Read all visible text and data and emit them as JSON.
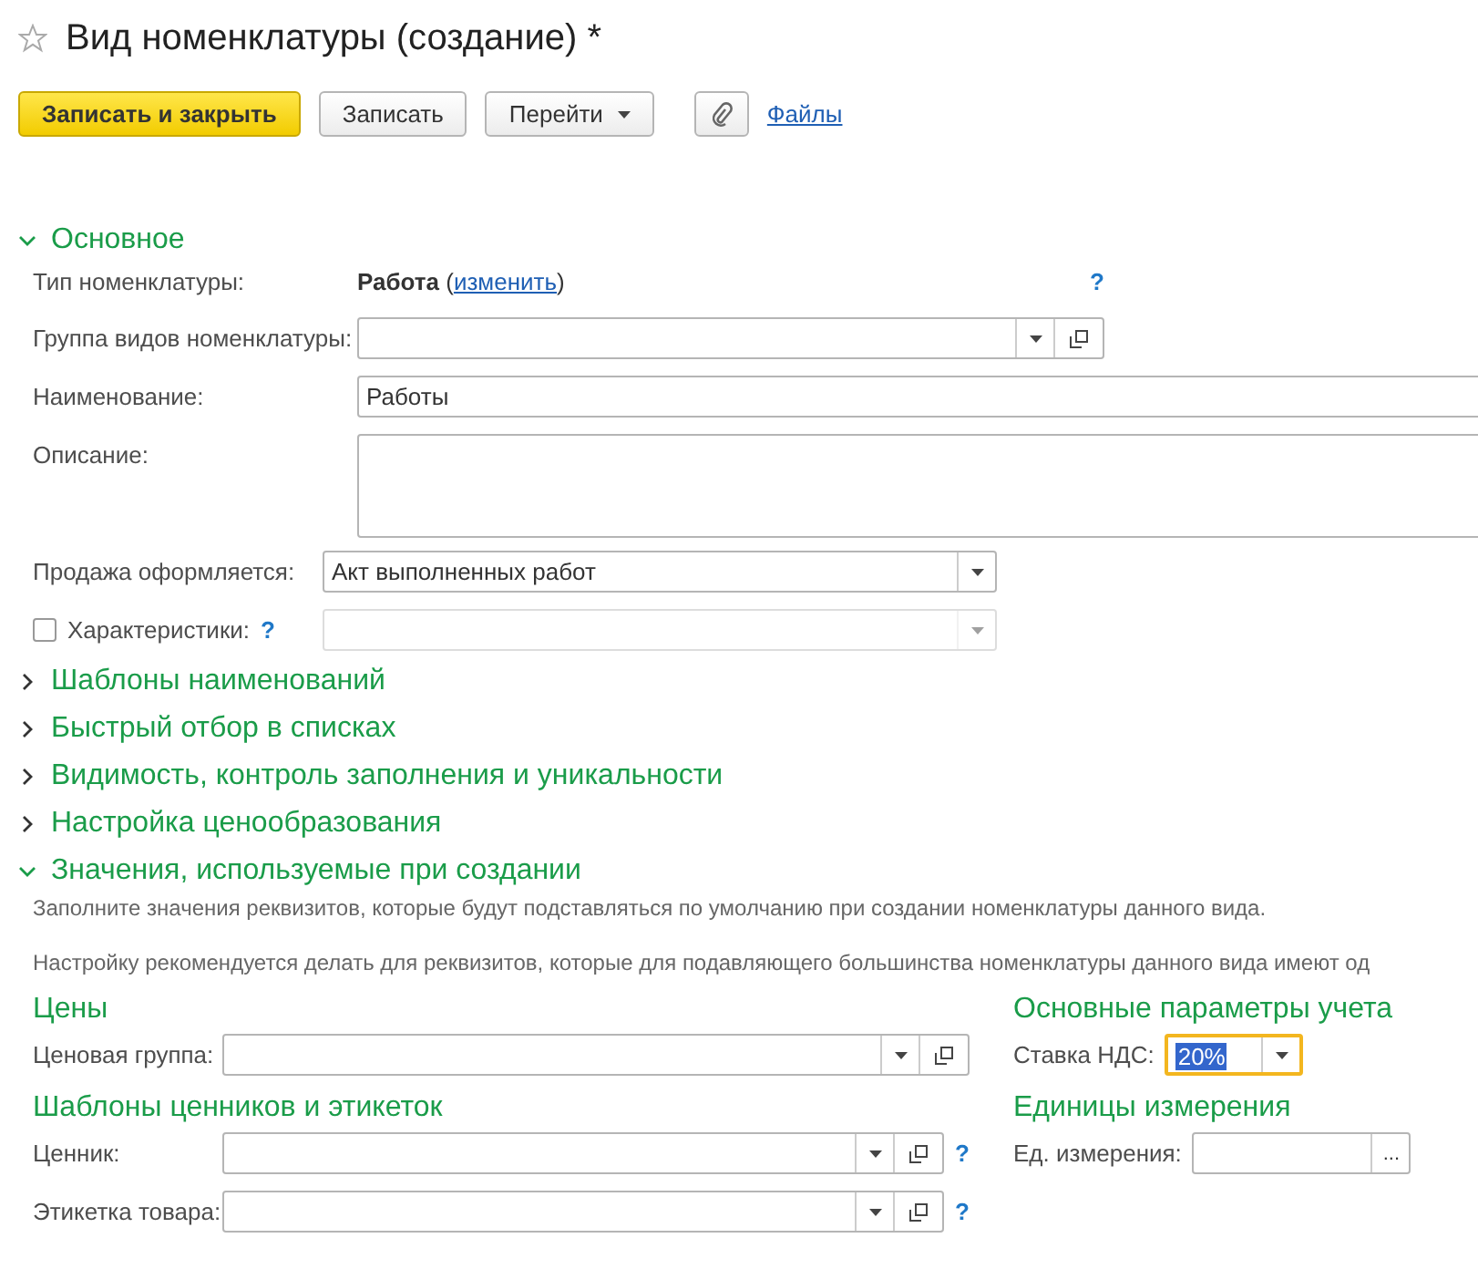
{
  "window": {
    "title": "Вид номенклатуры (создание) *",
    "favorite": false
  },
  "toolbar": {
    "buttons": [
      {
        "label": "Записать и закрыть",
        "kind": "primary"
      },
      {
        "label": "Записать",
        "kind": "plain"
      },
      {
        "label": "Перейти",
        "kind": "menu"
      }
    ],
    "files_link": "Файлы"
  },
  "main_section": {
    "title": "Основное",
    "expanded": true,
    "type_row": {
      "label": "Тип номенклатуры:",
      "value": "Работа",
      "before_link": "(",
      "link": "изменить",
      "after_link": ")",
      "help": "?"
    },
    "fields": [
      {
        "kind": "select_open",
        "label": "Группа видов номенклатуры:"
      },
      {
        "kind": "text",
        "label": "Наименование:",
        "value": "Работы"
      },
      {
        "kind": "textarea",
        "label": "Описание:"
      },
      {
        "kind": "select",
        "label": "Продажа оформляется:",
        "value": "Акт выполненных работ"
      },
      {
        "kind": "checkbox_select",
        "label": "Характеристики:",
        "checked": false,
        "help": "?",
        "disabled": true
      }
    ]
  },
  "collapsed_sections": [
    {
      "title": "Шаблоны наименований",
      "expanded": false
    },
    {
      "title": "Быстрый отбор в списках",
      "expanded": false
    },
    {
      "title": "Видимость, контроль заполнения и уникальности",
      "expanded": false
    },
    {
      "title": "Настройка ценообразования",
      "expanded": false
    }
  ],
  "values_section": {
    "title": "Значения, используемые при создании",
    "expanded": true,
    "notes": [
      "Заполните значения реквизитов, которые будут подставляться по умолчанию при создании номенклатуры данного вида.",
      "Настройку рекомендуется делать для реквизитов, которые для подавляющего большинства номенклатуры данного вида имеют од"
    ],
    "left_groups": [
      {
        "title": "Цены",
        "fields": [
          {
            "kind": "select_open",
            "label": "Ценовая группа:"
          }
        ]
      },
      {
        "title": "Шаблоны ценников и этикеток",
        "fields": [
          {
            "kind": "select_open",
            "label": "Ценник:",
            "help": "?"
          },
          {
            "kind": "select_open",
            "label": "Этикетка товара:",
            "help": "?"
          }
        ]
      }
    ],
    "right_groups": [
      {
        "title": "Основные параметры учета",
        "fields": [
          {
            "kind": "select",
            "label": "Ставка НДС:",
            "value": "20%",
            "focused": true
          }
        ]
      },
      {
        "title": "Единицы измерения",
        "fields": [
          {
            "kind": "choice",
            "label": "Ед. измерения:",
            "button": "..."
          }
        ]
      }
    ]
  }
}
